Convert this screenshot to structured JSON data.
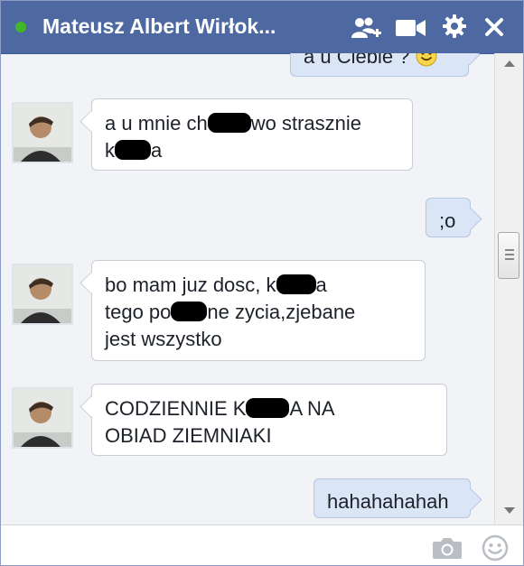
{
  "chat": {
    "title": "Mateusz Albert Wirłok...",
    "status": "online",
    "status_color": "#42b72a",
    "header_color": "#4e69a2",
    "header_icons": [
      "add-friend-icon",
      "video-call-icon",
      "gear-icon",
      "close-icon"
    ]
  },
  "messages": [
    {
      "direction": "outgoing",
      "text": "a u Ciebie ? ",
      "emoji": "smiley-emoji"
    },
    {
      "direction": "incoming",
      "line1_a": "a u mnie ch",
      "line1_b": "wo strasznie",
      "line2_a": "k",
      "line2_b": "a"
    },
    {
      "direction": "outgoing",
      "text": ";o"
    },
    {
      "direction": "incoming",
      "line1_a": "bo mam juz dosc, k",
      "line1_b": "a",
      "line2_a": "tego po",
      "line2_b": "ne zycia,zjebane",
      "line3": "jest wszystko"
    },
    {
      "direction": "incoming",
      "line1_a": "CODZIENNIE K",
      "line1_b": "A NA",
      "line2": "OBIAD ZIEMNIAKI"
    },
    {
      "direction": "outgoing",
      "text": "hahahahahah"
    }
  ],
  "footer": {
    "icons": [
      "camera-icon",
      "emoji-icon"
    ]
  }
}
